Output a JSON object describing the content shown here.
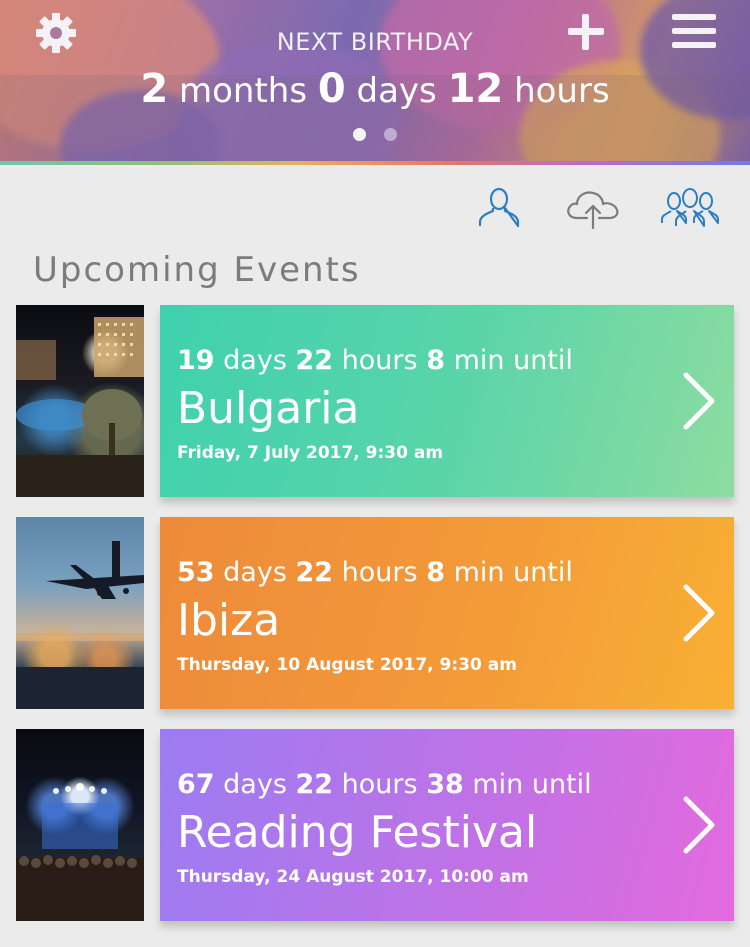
{
  "header": {
    "next_label": "NEXT BIRTHDAY",
    "countdown": {
      "months_value": "2",
      "months_unit": "months",
      "days_value": "0",
      "days_unit": "days",
      "hours_value": "12",
      "hours_unit": "hours"
    },
    "page_indicator": {
      "current": 1,
      "total": 2
    }
  },
  "icons": {
    "settings": "gear-icon",
    "add": "plus-icon",
    "menu": "hamburger-menu-icon",
    "person": "person-icon",
    "cloud_upload": "cloud-upload-icon",
    "group": "group-icon",
    "chevron": "chevron-right-icon"
  },
  "section": {
    "title": "Upcoming Events"
  },
  "events": [
    {
      "days_value": "19",
      "days_unit": "days",
      "hours_value": "22",
      "hours_unit": "hours",
      "min_value": "8",
      "min_unit": "min until",
      "title": "Bulgaria",
      "date": "Friday, 7 July 2017, 9:30 am",
      "color_from": "#3fd1ae",
      "color_to": "#8ddca0"
    },
    {
      "days_value": "53",
      "days_unit": "days",
      "hours_value": "22",
      "hours_unit": "hours",
      "min_value": "8",
      "min_unit": "min until",
      "title": "Ibiza",
      "date": "Thursday, 10 August 2017, 9:30 am",
      "color_from": "#ee8a3a",
      "color_to": "#f8b034"
    },
    {
      "days_value": "67",
      "days_unit": "days",
      "hours_value": "22",
      "hours_unit": "hours",
      "min_value": "38",
      "min_unit": "min until",
      "title": "Reading Festival",
      "date": "Thursday, 24 August 2017, 10:00 am",
      "color_from": "#9c7cf2",
      "color_to": "#e36ade"
    }
  ],
  "colors": {
    "background": "#ebebeb",
    "icon_blue": "#2d7fc4",
    "section_title": "#7c7c7c"
  }
}
